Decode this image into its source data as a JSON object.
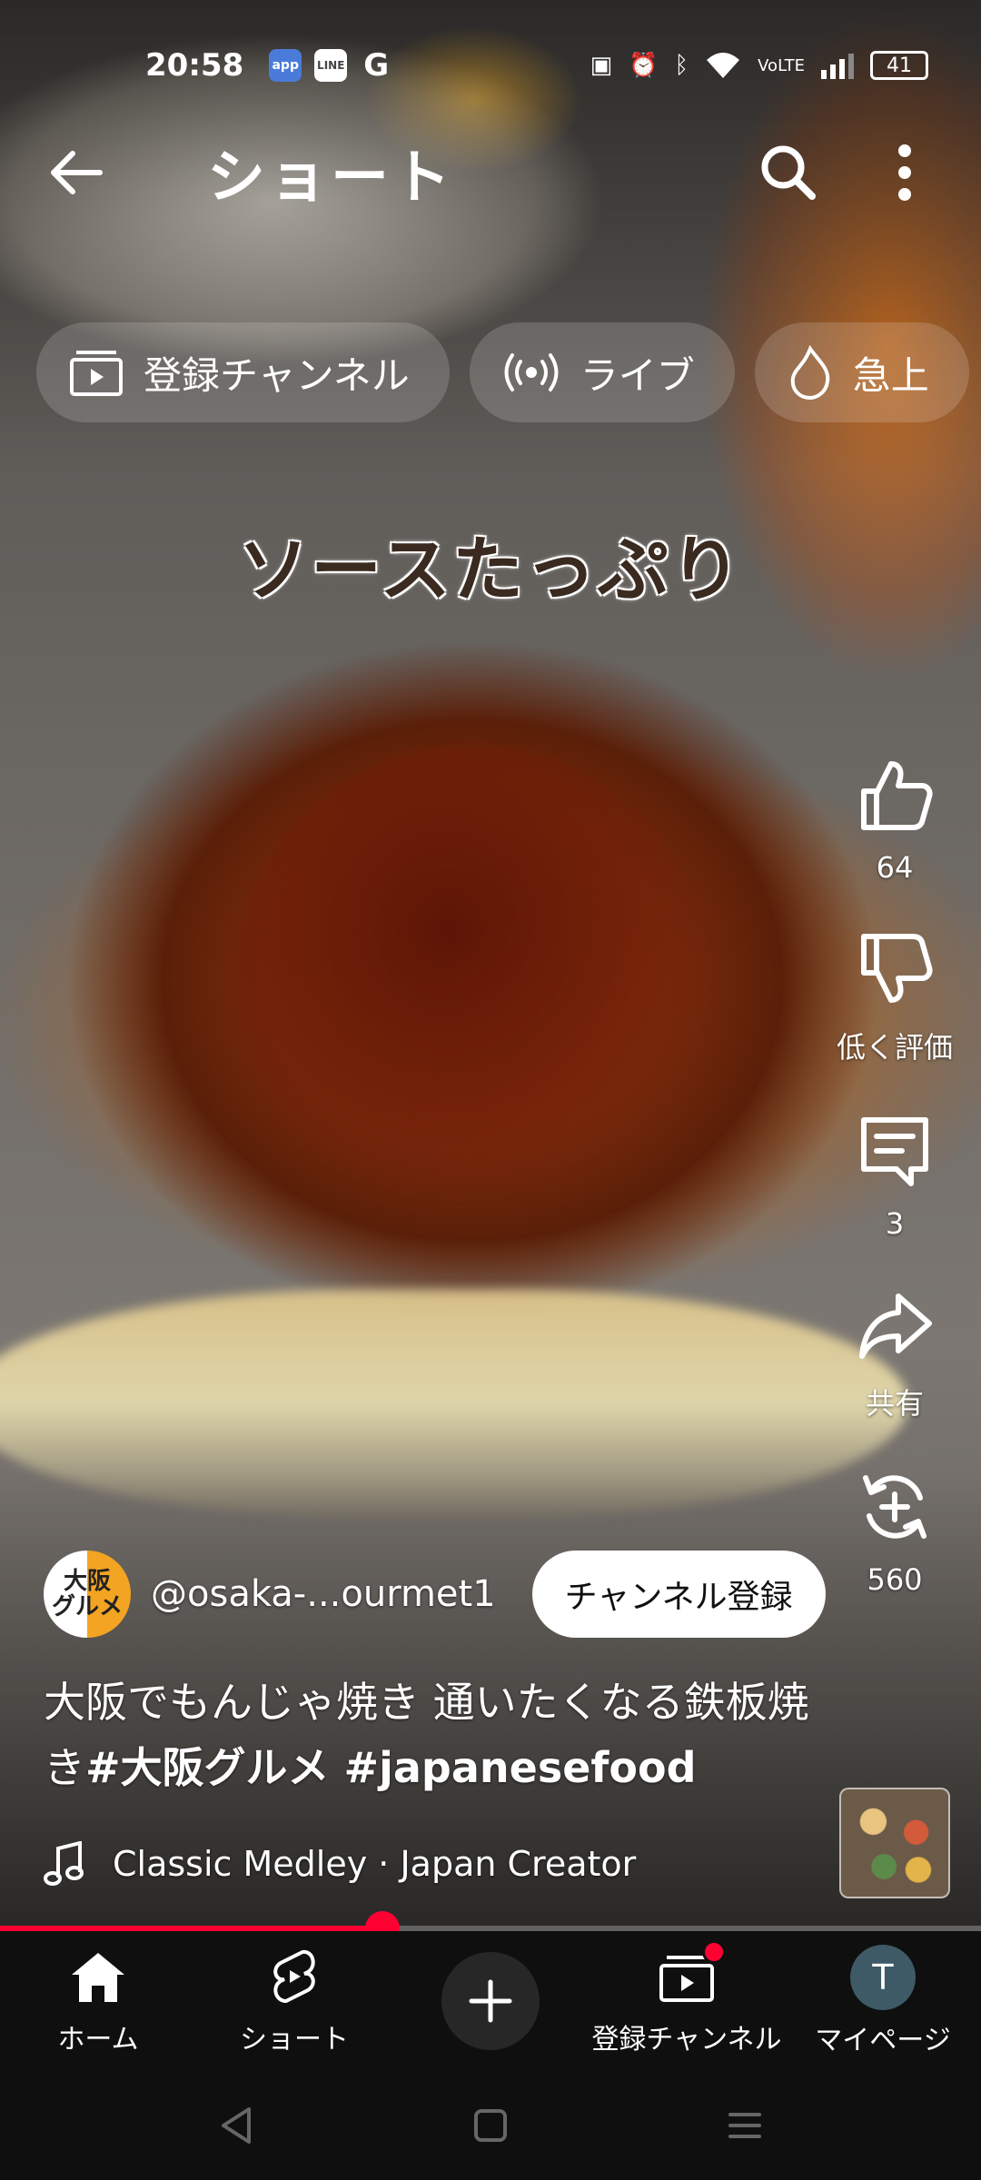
{
  "status_bar": {
    "time": "20:58",
    "notifications": [
      "app",
      "LINE",
      "G"
    ],
    "battery": "41"
  },
  "app_bar": {
    "title": "ショート"
  },
  "chips": [
    {
      "label": "登録チャンネル",
      "icon": "subscriptions-icon"
    },
    {
      "label": "ライブ",
      "icon": "live-icon"
    },
    {
      "label": "急上",
      "icon": "trending-icon"
    }
  ],
  "video": {
    "caption": "ソースたっぷり"
  },
  "actions": {
    "like_count": "64",
    "dislike_label": "低く評価",
    "comment_count": "3",
    "share_label": "共有",
    "remix_count": "560"
  },
  "channel": {
    "avatar_text": "大阪\nグルメ",
    "handle": "@osaka-...ourmet1",
    "subscribe_label": "チャンネル登録"
  },
  "short_title": {
    "text": "大阪でもんじゃ焼き 通いたくなる鉄板焼き",
    "hashtags": "#大阪グルメ #japanesefood"
  },
  "music": {
    "text": "Classic Medley · Japan Creator"
  },
  "progress": {
    "fraction": 0.39
  },
  "nav": {
    "home": "ホーム",
    "shorts": "ショート",
    "subscriptions": "登録チャンネル",
    "you": "マイページ",
    "user_initial": "T"
  },
  "colors": {
    "accent": "#ff0033",
    "nav_bg": "#0f0f0f"
  }
}
